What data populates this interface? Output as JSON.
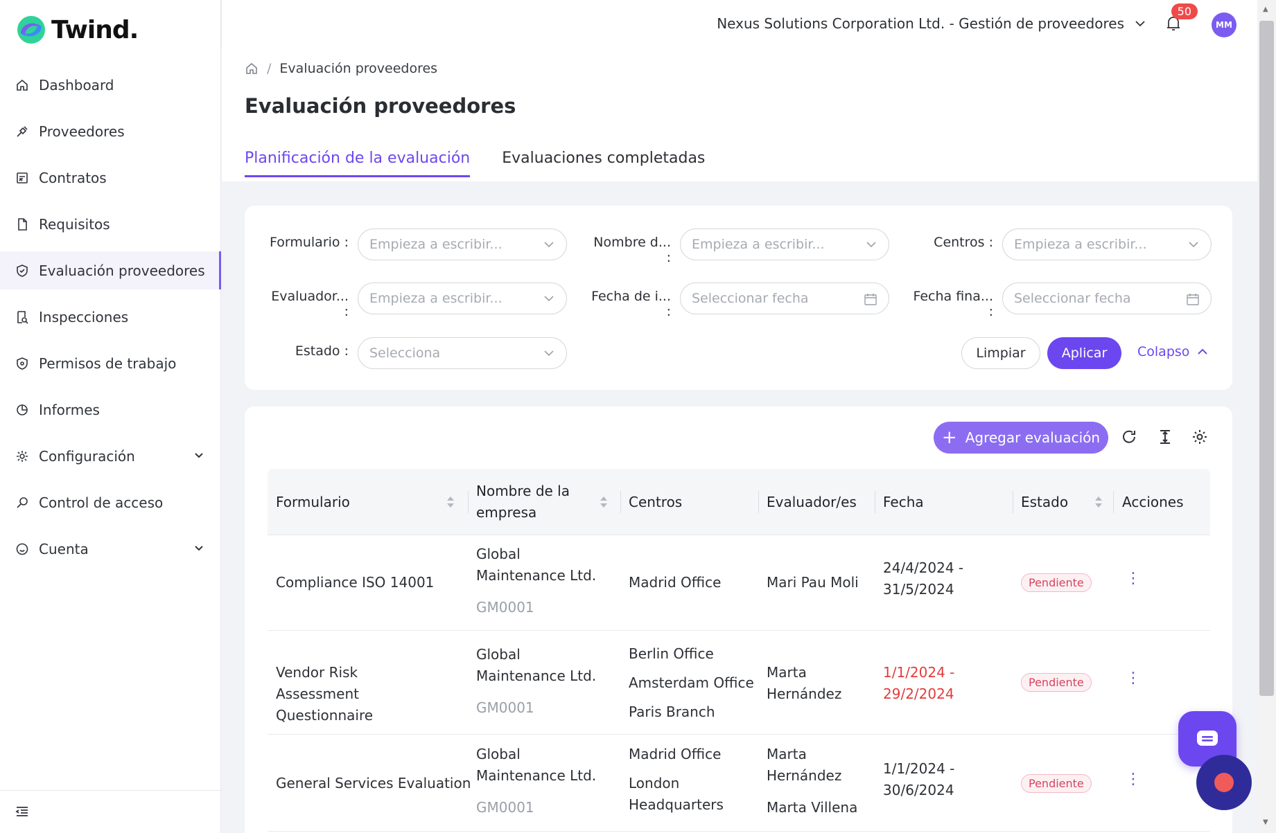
{
  "app": {
    "logo_text": "Twind."
  },
  "sidebar": {
    "items": [
      {
        "label": "Dashboard",
        "icon": "home-icon"
      },
      {
        "label": "Proveedores",
        "icon": "handshake-icon"
      },
      {
        "label": "Contratos",
        "icon": "contract-icon"
      },
      {
        "label": "Requisitos",
        "icon": "document-icon"
      },
      {
        "label": "Evaluación proveedores",
        "icon": "shield-check-icon",
        "active": true
      },
      {
        "label": "Inspecciones",
        "icon": "inspection-icon"
      },
      {
        "label": "Permisos de trabajo",
        "icon": "permit-icon"
      },
      {
        "label": "Informes",
        "icon": "pie-chart-icon"
      },
      {
        "label": "Configuración",
        "icon": "gear-icon",
        "expandable": true
      },
      {
        "label": "Control de acceso",
        "icon": "key-icon"
      },
      {
        "label": "Cuenta",
        "icon": "smile-icon",
        "expandable": true
      }
    ]
  },
  "topbar": {
    "organization": "Nexus Solutions Corporation Ltd. - Gestión de proveedores",
    "notifications_count": "50",
    "avatar_initials": "MM"
  },
  "breadcrumb": {
    "current": "Evaluación proveedores"
  },
  "page": {
    "title": "Evaluación proveedores"
  },
  "tabs": [
    {
      "label": "Planificación de la evaluación",
      "active": true
    },
    {
      "label": "Evaluaciones completadas",
      "active": false
    }
  ],
  "filters": {
    "formulario": {
      "label": "Formulario",
      "placeholder": "Empieza a escribir..."
    },
    "nombre": {
      "label": "Nombre d...",
      "placeholder": "Empieza a escribir..."
    },
    "centros": {
      "label": "Centros",
      "placeholder": "Empieza a escribir..."
    },
    "evaluador": {
      "label": "Evaluador...",
      "placeholder": "Empieza a escribir..."
    },
    "fecha_inicio": {
      "label": "Fecha de i...",
      "placeholder": "Seleccionar fecha"
    },
    "fecha_fin": {
      "label": "Fecha fina...",
      "placeholder": "Seleccionar fecha"
    },
    "estado": {
      "label": "Estado",
      "placeholder": "Selecciona"
    },
    "clear_label": "Limpiar",
    "apply_label": "Aplicar",
    "collapse_label": "Colapso"
  },
  "table": {
    "add_label": "Agregar evaluación",
    "columns": [
      "Formulario",
      "Nombre de la empresa",
      "Centros",
      "Evaluador/es",
      "Fecha",
      "Estado",
      "Acciones"
    ],
    "rows": [
      {
        "formulario": "Compliance ISO 14001",
        "empresa": "Global Maintenance Ltd.",
        "codigo": "GM0001",
        "centros": [
          "Madrid Office"
        ],
        "evaluadores": [
          "Mari Pau Moli"
        ],
        "fecha": "24/4/2024 - 31/5/2024",
        "fecha_overdue": false,
        "estado": "Pendiente"
      },
      {
        "formulario": "Vendor Risk Assessment Questionnaire",
        "empresa": "Global Maintenance Ltd.",
        "codigo": "GM0001",
        "centros": [
          "Berlin Office",
          "Amsterdam Office",
          "Paris Branch"
        ],
        "evaluadores": [
          "Marta Hernández"
        ],
        "fecha": "1/1/2024 - 29/2/2024",
        "fecha_overdue": true,
        "estado": "Pendiente"
      },
      {
        "formulario": "General Services Evaluation",
        "empresa": "Global Maintenance Ltd.",
        "codigo": "GM0001",
        "centros": [
          "Madrid Office",
          "London Headquarters"
        ],
        "evaluadores": [
          "Marta Hernández",
          "Marta Villena"
        ],
        "fecha": "1/1/2024 - 30/6/2024",
        "fecha_overdue": false,
        "estado": "Pendiente"
      }
    ]
  },
  "colors": {
    "accent": "#6c47ef",
    "overdue": "#e23b3b",
    "status_pending": "#d3455f"
  }
}
